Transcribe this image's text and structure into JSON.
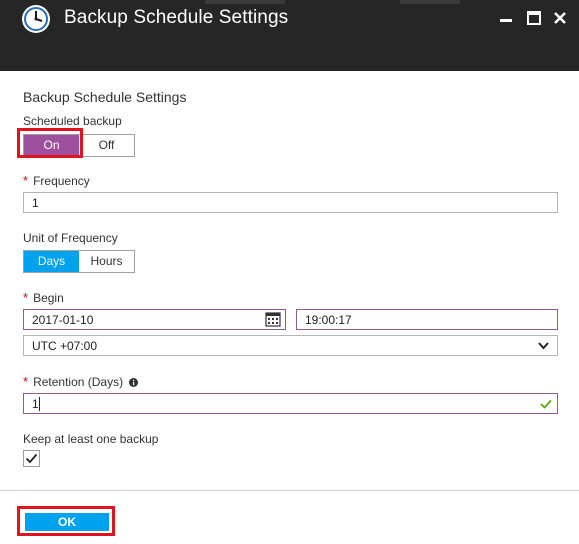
{
  "window": {
    "title": "Backup Schedule Settings",
    "controls": [
      "minimize-icon",
      "maximize-icon",
      "close-icon"
    ]
  },
  "form": {
    "section_title": "Backup Schedule Settings",
    "scheduled_backup": {
      "label": "Scheduled backup",
      "on_label": "On",
      "off_label": "Off",
      "selected": "On"
    },
    "frequency": {
      "required_mark": "*",
      "label": "Frequency",
      "value": "1"
    },
    "unit_of_frequency": {
      "label": "Unit of Frequency",
      "days_label": "Days",
      "hours_label": "Hours",
      "selected": "Days"
    },
    "begin": {
      "required_mark": "*",
      "label": "Begin",
      "date": "2017-01-10",
      "time": "19:00:17",
      "timezone": "UTC +07:00"
    },
    "retention": {
      "required_mark": "*",
      "label": "Retention (Days)",
      "value": "1"
    },
    "keep_backup": {
      "label": "Keep at least one backup",
      "checked": true
    }
  },
  "footer": {
    "ok_label": "OK"
  },
  "colors": {
    "titlebar_bg": "#262626",
    "toggle_on": "#9e4f9e",
    "selected_blue": "#00a2ed",
    "required": "#d0021b",
    "highlight_red": "#e0141e",
    "valid_check": "#5aa700"
  }
}
